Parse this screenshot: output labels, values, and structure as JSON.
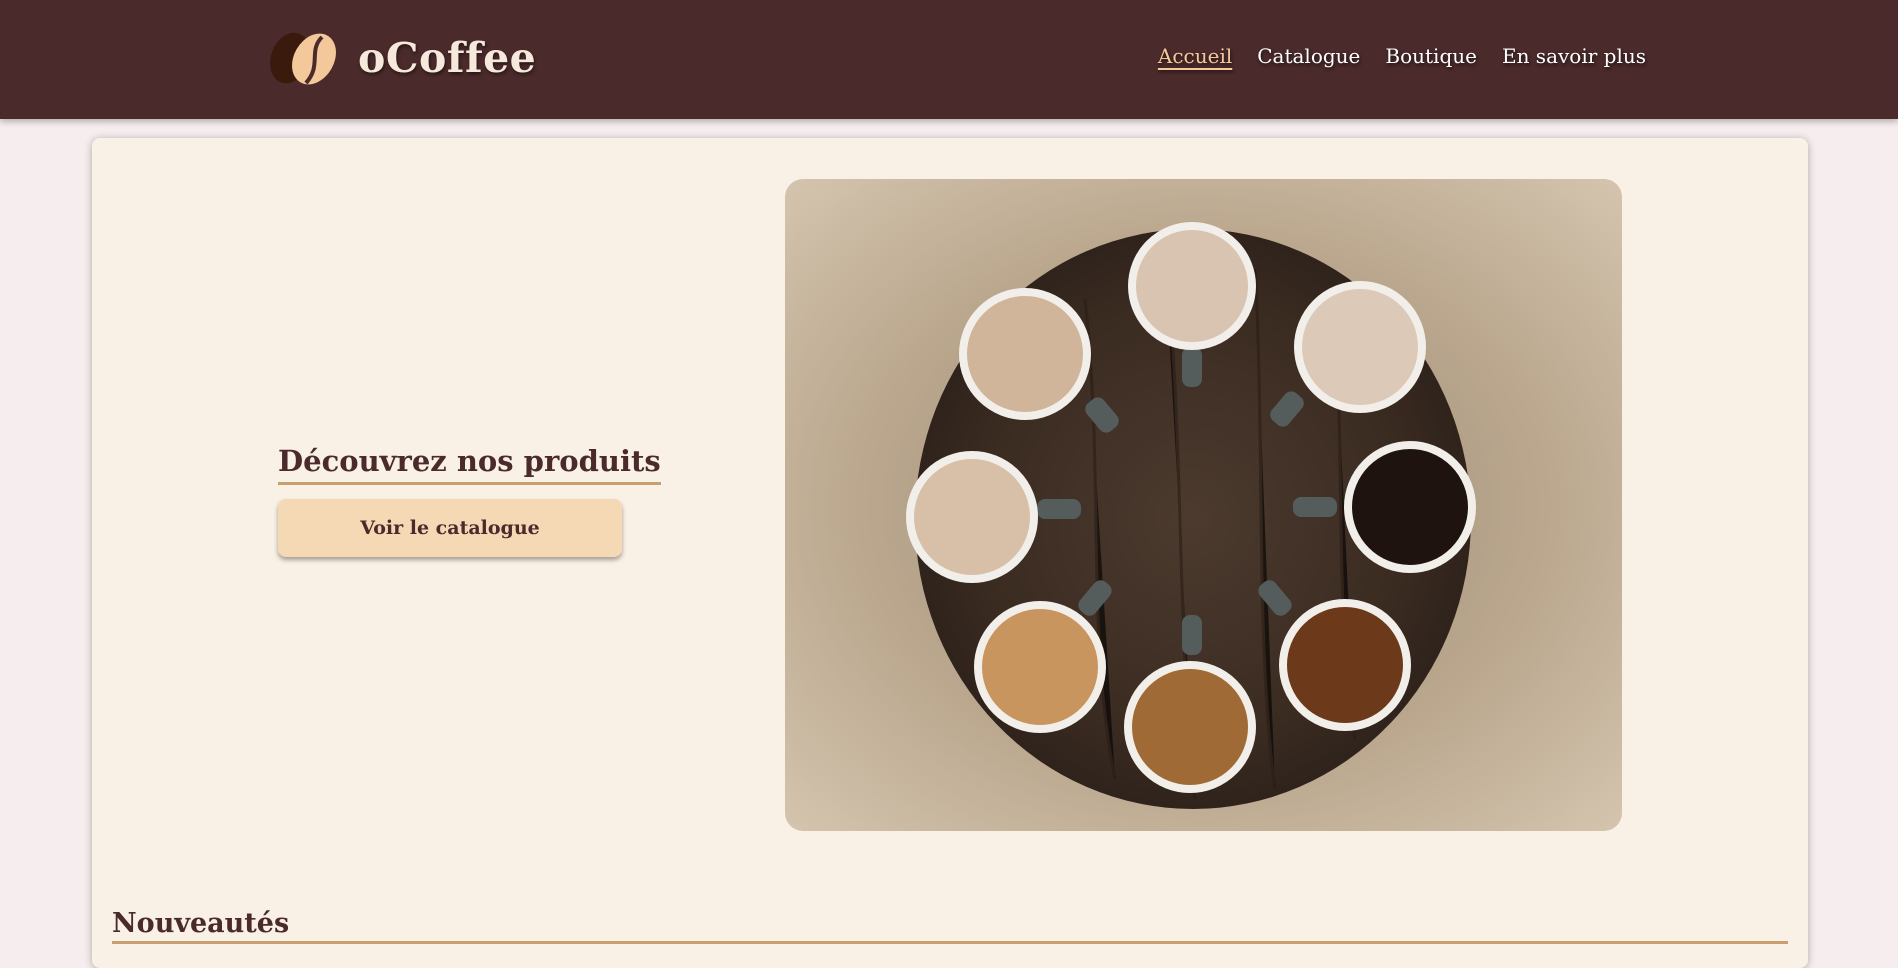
{
  "brand": {
    "name": "oCoffee",
    "logo_icon": "coffee-bean-icon"
  },
  "nav": {
    "items": [
      {
        "label": "Accueil",
        "active": true
      },
      {
        "label": "Catalogue",
        "active": false
      },
      {
        "label": "Boutique",
        "active": false
      },
      {
        "label": "En savoir plus",
        "active": false
      }
    ]
  },
  "hero": {
    "title": "Découvrez nos produits",
    "cta_label": "Voir le catalogue",
    "image_alt": "coffee-cups-table-photo"
  },
  "sections": {
    "new_title": "Nouveautés"
  },
  "colors": {
    "header_bg": "#4a2a2b",
    "accent": "#f3c89a",
    "card_bg": "#faf1e6",
    "button_bg": "#f5d8b4",
    "underline": "#c8a070"
  }
}
